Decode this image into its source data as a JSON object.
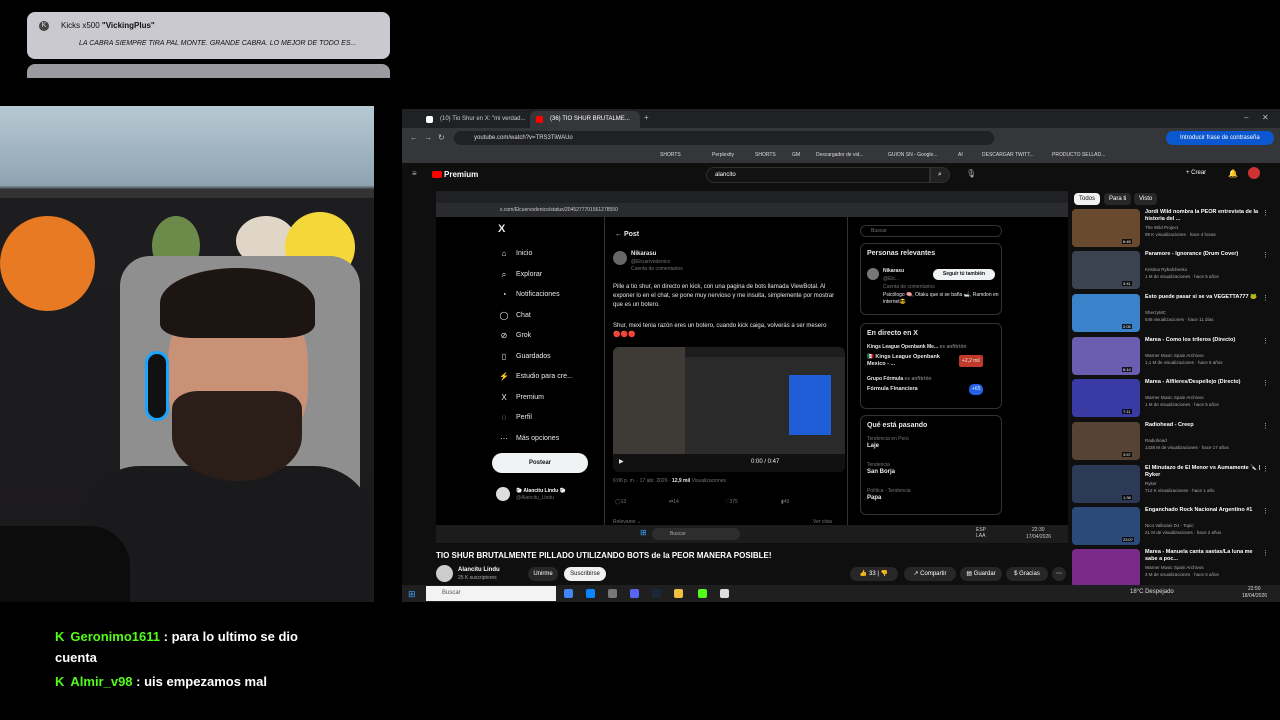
{
  "alert": {
    "label": "Kicks x500 ",
    "user": "\"VickingPlus\"",
    "message": "LA CABRA SIEMPRE TIRA PAL MONTE. GRANDE CABRA. LO MEJOR DE TODO ES..."
  },
  "chat": [
    {
      "user": "Geronimo1611",
      "text": ": para lo ultimo se dio",
      "cont": "cuenta"
    },
    {
      "user": "Almir_v98",
      "text": ": uis empezamos mal"
    }
  ],
  "browser": {
    "tabs": [
      "(10) Tio Shur en X: \"mi verdad...",
      "(36) TIO SHUR BRUTALME..."
    ],
    "url": "youtube.com/watch?v=TRS3TiWAUo",
    "password_button": "Introducir frase de contraseña",
    "bookmarks": [
      "SHORTS",
      "Perplexity",
      "SHORTS",
      "GM",
      "Descargador de vid...",
      "GUION SN - Google...",
      "AI",
      "DESCARGAR TWITT...",
      "PRODUCTO SELLAD..."
    ]
  },
  "youtube": {
    "logo": "Premium",
    "search": "alancito",
    "create": "Crear",
    "chips": [
      "Todos",
      "Para ti",
      "Visto"
    ],
    "video_title": "TIO SHUR BRUTALMENTE PILLADO UTILIZANDO BOTS de la PEOR MANERA POSIBLE!",
    "channel": "Alancitu Lindu",
    "subs": "25 K suscriptores",
    "unirme": "Unirme",
    "subscribe": "Suscribirse",
    "likes": "33",
    "share": "Compartir",
    "save": "Guardar",
    "thanks": "Gracias",
    "recs": [
      {
        "title": "Jordi Wild nombra la PEOR entrevista de la historia del ...",
        "channel": "The Wild Project",
        "views": "99 K visualizaciones · hace 4 horas",
        "dur": "6:45",
        "color": "#6a4a2e"
      },
      {
        "title": "Paramore - Ignorance (Drum Cover)",
        "channel": "Kristina Rybalchenko",
        "views": "1 M de visualizaciones · hace 5 años",
        "dur": "3:41",
        "color": "#3b4250"
      },
      {
        "title": "Esto puede pasar si se va VEGETTA777 🐸",
        "channel": "SherzyMC",
        "views": "545 visualizaciones · hace 11 días",
        "dur": "2:05",
        "color": "#3a82c9"
      },
      {
        "title": "Marea - Como los trileros (Directo)",
        "channel": "Warner Music Spain Archivos",
        "views": "1,1 M de visualizaciones · hace 5 años",
        "dur": "6:14",
        "color": "#6b5db0"
      },
      {
        "title": "Marea - Alfileres/Despellejo (Directo)",
        "channel": "Warner Music Spain Archivos",
        "views": "1 M de visualizaciones · hace 5 años",
        "dur": "7:11",
        "color": "#3a3aa5"
      },
      {
        "title": "Radiohead - Creep",
        "channel": "Radiohead",
        "views": "1438 M de visualizaciones · hace 17 años",
        "dur": "3:57",
        "color": "#574236"
      },
      {
        "title": "El Minutazo de El Menor vs Aumamente 🔪 | Ryker",
        "channel": "Ryker",
        "views": "712 K visualizaciones · hace 1 año",
        "dur": "1:38",
        "color": "#2d3a57"
      },
      {
        "title": "Enganchado Rock Nacional Argentino #1",
        "channel": "Nico Vallorani DJ - Topic",
        "views": "21 M de visualizaciones · hace 2 años",
        "dur": "23:07",
        "color": "#2b4a7a"
      },
      {
        "title": "Marea - Manuela canta saetas/La luna me sabe a poc...",
        "channel": "Warner Music Spain Archivos",
        "views": "3 M de visualizaciones · hace 5 años",
        "dur": "",
        "color": "#7a2b8a"
      }
    ]
  },
  "x": {
    "logo": "X",
    "nav": [
      "Inicio",
      "Explorar",
      "Notificaciones",
      "Chat",
      "Grok",
      "Guardados",
      "Estudio para cre...",
      "Premium",
      "Perfil",
      "Más opciones"
    ],
    "post_button": "Postear",
    "profile_name": "🐑 Alancitu Lindu 🐑",
    "profile_handle": "@Alancitu_Lindu",
    "post_header": "Post",
    "url": "x.com/Elcuervodenico/status/2045277701561278550",
    "author": "Nikarasu",
    "handle": "@Elcuervodenico",
    "account_note": "Cuenta de comentarios",
    "text1": "Pille a tio shur, en directo en kick, con una pagina de bots llamada ViewBotal. Al exponer lo en el chat, se pone muy  nervioso y me insulta, simplemente por mostrar que es un botero.",
    "text2": "Shur, mexi tenia razón eres un botero,  cuando kick caiga, volverás a ser mesero 🔴🔴🔴",
    "time": "0:00 / 0:47",
    "meta_date": "6:06 p. m. · 17 abr. 2026 · ",
    "meta_views": "12,9 mil",
    "meta_views_label": " Visualizaciones",
    "replies": "13",
    "reposts": "14",
    "likes": "375",
    "bookmarks": "49",
    "relevant": "Relevante",
    "see_quotes": "Ver citas",
    "search": "Buscar",
    "people_title": "Personas relevantes",
    "people_name": "Nikarasu",
    "people_handle": "@Elc...",
    "follow_back": "Seguir tú también",
    "people_bio": "Psicólogo 🧠, Otaku que si se baña 🛁, Ramdon en internet😎",
    "live_title": "En directo en X",
    "live1": "Kings League Openbank Me...",
    "live1_badge": "es anfitrión",
    "live2": "🇲🇽 Kings League Openbank Mexico - ...",
    "live2_count": "+2,2 mil",
    "live3": "Grupo Fórmula",
    "live3_badge": "es anfitrión",
    "live3_title": "Fórmula Financiera",
    "live3_count": "+65",
    "trend_title": "Qué está pasando",
    "trends": [
      {
        "cat": "Tendencia en Perú",
        "name": "Laje"
      },
      {
        "cat": "Tendencia",
        "name": "San Borja"
      },
      {
        "cat": "Política · Tendencia",
        "name": "Papa"
      }
    ],
    "taskbar_search": "Buscar",
    "taskbar_lang": "ESP LAA",
    "taskbar_time": "22:30",
    "taskbar_date": "17/04/2026"
  },
  "taskbar": {
    "search": "Buscar",
    "weather": "18°C  Despejado",
    "time": "22:50",
    "date": "18/04/2026"
  }
}
